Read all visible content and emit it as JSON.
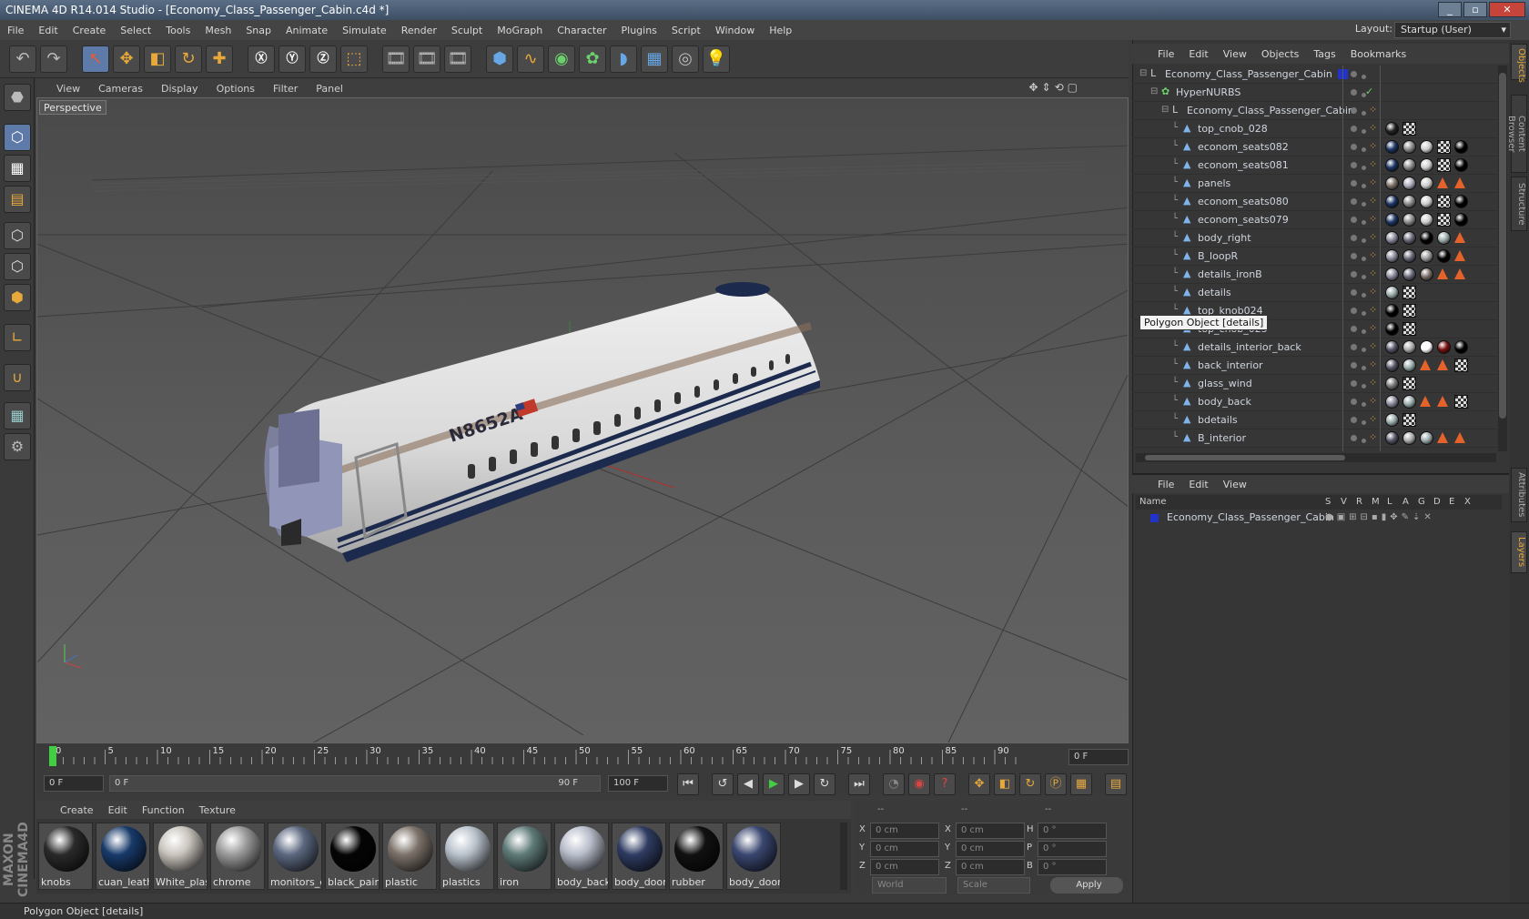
{
  "window": {
    "title": "CINEMA 4D R14.014 Studio - [Economy_Class_Passenger_Cabin.c4d *]"
  },
  "menu": [
    "File",
    "Edit",
    "Create",
    "Select",
    "Tools",
    "Mesh",
    "Snap",
    "Animate",
    "Simulate",
    "Render",
    "Sculpt",
    "MoGraph",
    "Character",
    "Plugins",
    "Script",
    "Window",
    "Help"
  ],
  "layout": {
    "label": "Layout:",
    "value": "Startup (User)"
  },
  "viewport": {
    "menu": [
      "View",
      "Cameras",
      "Display",
      "Options",
      "Filter",
      "Panel"
    ],
    "label": "Perspective",
    "registration": "N8652A"
  },
  "timeline": {
    "ticks": [
      "0",
      "5",
      "10",
      "15",
      "20",
      "25",
      "30",
      "35",
      "40",
      "45",
      "50",
      "55",
      "60",
      "65",
      "70",
      "75",
      "80",
      "85",
      "90"
    ],
    "current_frame": "0 F",
    "start": "0 F",
    "range_start": "0 F",
    "range_end": "90 F",
    "end": "100 F"
  },
  "materials": {
    "menu": [
      "Create",
      "Edit",
      "Function",
      "Texture"
    ],
    "items": [
      {
        "label": "knobs",
        "color": "#2a2a2a"
      },
      {
        "label": "cuan_leath",
        "color": "#183a6a"
      },
      {
        "label": "White_plas",
        "color": "#c9c4bd"
      },
      {
        "label": "chrome",
        "color": "#9a9a9a"
      },
      {
        "label": "monitors_e",
        "color": "#5c6880"
      },
      {
        "label": "black_pain",
        "color": "#050505"
      },
      {
        "label": "plastic",
        "color": "#7c726a"
      },
      {
        "label": "plastics",
        "color": "#b9c2cc"
      },
      {
        "label": "iron",
        "color": "#5e7a78"
      },
      {
        "label": "body_back",
        "color": "#b7bdca"
      },
      {
        "label": "body_door",
        "color": "#2f3c62"
      },
      {
        "label": "rubber",
        "color": "#111111"
      },
      {
        "label": "body_door",
        "color": "#3a4770"
      }
    ]
  },
  "coords": {
    "header": [
      "--",
      "--",
      "--"
    ],
    "rows": [
      {
        "a": "X",
        "av": "0 cm",
        "b": "X",
        "bv": "0 cm",
        "c": "H",
        "cv": "0 °"
      },
      {
        "a": "Y",
        "av": "0 cm",
        "b": "Y",
        "bv": "0 cm",
        "c": "P",
        "cv": "0 °"
      },
      {
        "a": "Z",
        "av": "0 cm",
        "b": "Z",
        "bv": "0 cm",
        "c": "B",
        "cv": "0 °"
      }
    ],
    "mode": "World",
    "scale": "Scale",
    "apply": "Apply"
  },
  "objects": {
    "menu": [
      "File",
      "Edit",
      "View",
      "Objects",
      "Tags",
      "Bookmarks"
    ],
    "rows": [
      {
        "name": "Economy_Class_Passenger_Cabin",
        "level": 0,
        "icon": "null-icon",
        "tags": []
      },
      {
        "name": "HyperNURBS",
        "level": 1,
        "icon": "hypernurbs-icon",
        "tags": []
      },
      {
        "name": "Economy_Class_Passenger_Cabin",
        "level": 2,
        "icon": "null-icon",
        "tags": []
      },
      {
        "name": "top_cnob_028",
        "level": 3,
        "icon": "polygon-icon",
        "tags": [
          "#222",
          "chk"
        ]
      },
      {
        "name": "econom_seats082",
        "level": 3,
        "icon": "polygon-icon",
        "tags": [
          "#1c3563",
          "#888",
          "#ccc",
          "chk",
          "#000"
        ]
      },
      {
        "name": "econom_seats081",
        "level": 3,
        "icon": "polygon-icon",
        "tags": [
          "#1c3563",
          "#888",
          "#ccc",
          "chk",
          "#000"
        ]
      },
      {
        "name": "panels",
        "level": 3,
        "icon": "polygon-icon",
        "tags": [
          "#7a6e66",
          "#aab",
          "#ccc",
          "tri",
          "tri"
        ]
      },
      {
        "name": "econom_seats080",
        "level": 3,
        "icon": "polygon-icon",
        "tags": [
          "#1c3563",
          "#888",
          "#ccc",
          "chk",
          "#000"
        ]
      },
      {
        "name": "econom_seats079",
        "level": 3,
        "icon": "polygon-icon",
        "tags": [
          "#1c3563",
          "#888",
          "#ccc",
          "chk",
          "#000"
        ]
      },
      {
        "name": "body_right",
        "level": 3,
        "icon": "polygon-icon",
        "tags": [
          "#889",
          "#667",
          "#000",
          "#9aa",
          "tri"
        ]
      },
      {
        "name": "B_loopR",
        "level": 3,
        "icon": "polygon-icon",
        "tags": [
          "#889",
          "#667",
          "#999",
          "#000",
          "tri"
        ]
      },
      {
        "name": "details_ironB",
        "level": 3,
        "icon": "polygon-icon",
        "tags": [
          "#889",
          "#667",
          "#7a6e66",
          "tri",
          "tri"
        ]
      },
      {
        "name": "details",
        "level": 3,
        "icon": "polygon-icon",
        "tags": [
          "#9aa",
          "chk"
        ]
      },
      {
        "name": "top_knob024",
        "level": 3,
        "icon": "polygon-icon",
        "tags": [
          "#000",
          "chk"
        ]
      },
      {
        "name": "top_cnob_025",
        "level": 3,
        "icon": "polygon-icon",
        "tags": [
          "#000",
          "chk"
        ]
      },
      {
        "name": "details_interior_back",
        "level": 3,
        "icon": "polygon-icon",
        "tags": [
          "#556",
          "#aaa",
          "#fff",
          "#7a1111",
          "#000"
        ]
      },
      {
        "name": "back_interior",
        "level": 3,
        "icon": "polygon-icon",
        "tags": [
          "#556",
          "#9aa",
          "tri",
          "tri",
          "chk"
        ]
      },
      {
        "name": "glass_wind",
        "level": 3,
        "icon": "polygon-icon",
        "tags": [
          "#777",
          "chk"
        ]
      },
      {
        "name": "body_back",
        "level": 3,
        "icon": "polygon-icon",
        "tags": [
          "#889",
          "#9aa",
          "tri",
          "tri",
          "chk"
        ]
      },
      {
        "name": "bdetails",
        "level": 3,
        "icon": "polygon-icon",
        "tags": [
          "#9aa",
          "chk"
        ]
      },
      {
        "name": "B_interior",
        "level": 3,
        "icon": "polygon-icon",
        "tags": [
          "#556",
          "#aaa",
          "#9aa",
          "tri",
          "tri"
        ]
      }
    ],
    "tooltip": "Polygon Object [details]"
  },
  "layers": {
    "menu": [
      "File",
      "Edit",
      "View"
    ],
    "columns": [
      "Name",
      "S",
      "V",
      "R",
      "M",
      "L",
      "A",
      "G",
      "D",
      "E",
      "X"
    ],
    "row": "Economy_Class_Passenger_Cabin"
  },
  "sidetabs": [
    "Objects",
    "Content Browser",
    "Structure",
    "Attributes",
    "Layers"
  ],
  "status": "Polygon Object [details]",
  "brand": "MAXON CINEMA4D"
}
